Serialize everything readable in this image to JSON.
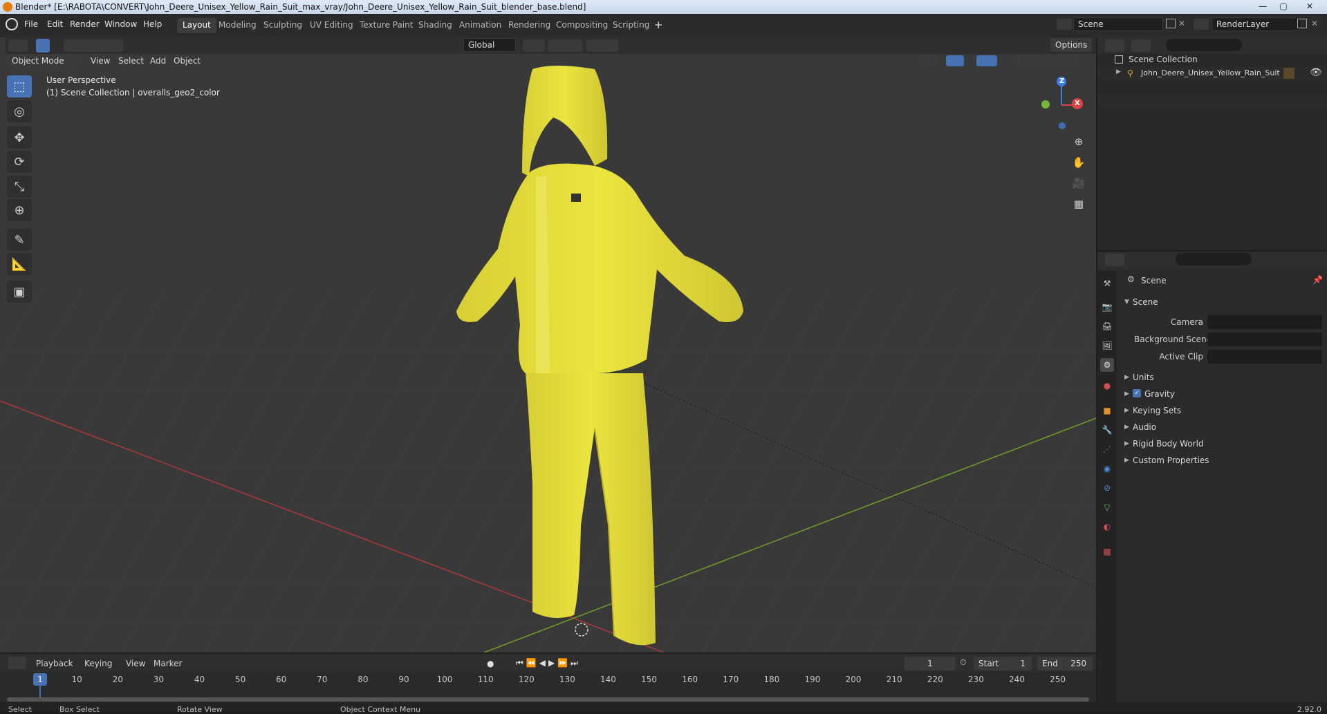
{
  "window": {
    "title": "Blender* [E:\\RABOTA\\CONVERT\\John_Deere_Unisex_Yellow_Rain_Suit_max_vray/John_Deere_Unisex_Yellow_Rain_Suit_blender_base.blend]",
    "minimize": "—",
    "maximize": "▢",
    "close": "✕"
  },
  "menu": [
    "File",
    "Edit",
    "Render",
    "Window",
    "Help"
  ],
  "workspaces": [
    "Layout",
    "Modeling",
    "Sculpting",
    "UV Editing",
    "Texture Paint",
    "Shading",
    "Animation",
    "Rendering",
    "Compositing",
    "Scripting"
  ],
  "active_workspace": "Layout",
  "add_workspace": "+",
  "scene_field": "Scene",
  "renderlayer_field": "RenderLayer",
  "viewport": {
    "transform_orientation": "Global",
    "options_label": "Options",
    "mode": "Object Mode",
    "menus": [
      "View",
      "Select",
      "Add",
      "Object"
    ],
    "overlay_line1": "User Perspective",
    "overlay_line2": "(1) Scene Collection | overalls_geo2_color",
    "gizmo_z": "Z",
    "gizmo_x": "X",
    "colors": {
      "background": "#3a3a3a",
      "x_axis": "#a8383c",
      "y_axis": "#6d9a2a",
      "suit": "#e5dc3c",
      "active": "#4772b3"
    }
  },
  "outliner": {
    "root": "Scene Collection",
    "items": [
      {
        "label": "John_Deere_Unisex_Yellow_Rain_Suit"
      }
    ]
  },
  "properties": {
    "context": "Scene",
    "section": "Scene",
    "fields": [
      {
        "label": "Camera"
      },
      {
        "label": "Background Scene"
      },
      {
        "label": "Active Clip"
      }
    ],
    "panels": [
      "Units",
      "Gravity",
      "Keying Sets",
      "Audio",
      "Rigid Body World",
      "Custom Properties"
    ],
    "gravity_checked": true
  },
  "timeline": {
    "menus": [
      "Playback",
      "Keying",
      "View",
      "Marker"
    ],
    "current_frame": "1",
    "start_label": "Start",
    "start": "1",
    "end_label": "End",
    "end": "250",
    "ticks": [
      "1",
      "10",
      "20",
      "30",
      "40",
      "50",
      "60",
      "70",
      "80",
      "90",
      "100",
      "110",
      "120",
      "130",
      "140",
      "150",
      "160",
      "170",
      "180",
      "190",
      "200",
      "210",
      "220",
      "230",
      "240",
      "250"
    ]
  },
  "status_bar": [
    "Select",
    "Box Select",
    "Rotate View",
    "Object Context Menu"
  ],
  "version": "2.92.0"
}
